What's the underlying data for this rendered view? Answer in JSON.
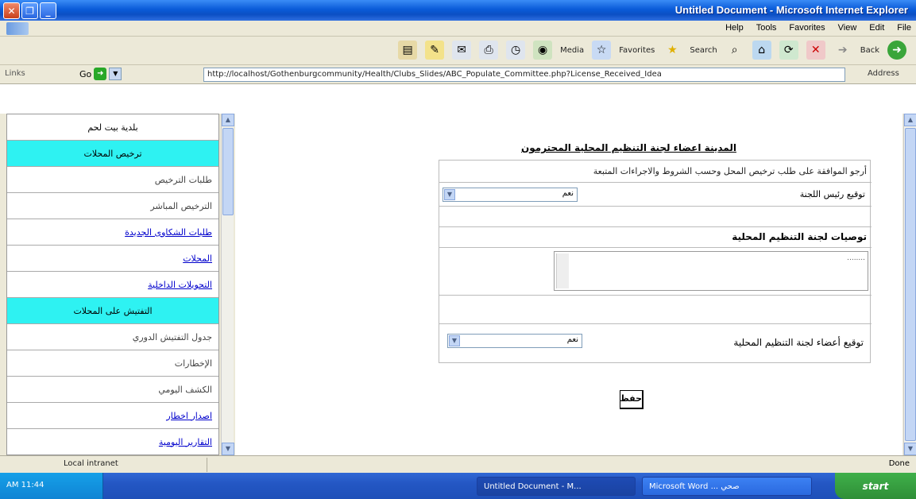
{
  "window": {
    "title": "Untitled Document - Microsoft Internet Explorer"
  },
  "menu": {
    "items": [
      "Help",
      "Tools",
      "Favorites",
      "View",
      "Edit",
      "File"
    ]
  },
  "toolbar": {
    "media": "Media",
    "favorites": "Favorites",
    "search": "Search",
    "back": "Back"
  },
  "addressbar": {
    "links": "Links",
    "go": "Go",
    "url": "http://localhost/Gothenburgcommunity/Health/Clubs_Slides/ABC_Populate_Committee.php?License_Received_Idea",
    "label": "Address"
  },
  "sidebar": {
    "items": [
      {
        "text": "بلدية بيت لحم",
        "kind": "top"
      },
      {
        "text": "ترخيص المحلات",
        "kind": "header"
      },
      {
        "text": "طلبات الترخيص",
        "kind": "plain"
      },
      {
        "text": "الترخيص المباشر",
        "kind": "plain"
      },
      {
        "text": "طلبات الشكاوى الجديدة",
        "kind": "link"
      },
      {
        "text": "المحلات",
        "kind": "link"
      },
      {
        "text": "التحويلات الداخلية",
        "kind": "link"
      },
      {
        "text": "التفتيش على المحلات",
        "kind": "header"
      },
      {
        "text": "جدول التفتيش الدوري",
        "kind": "plain"
      },
      {
        "text": "الإخطارات",
        "kind": "plain"
      },
      {
        "text": "الكشف اليومي",
        "kind": "plain"
      },
      {
        "text": "اصدار اخطار",
        "kind": "link"
      },
      {
        "text": "التقارير اليومية",
        "kind": "link"
      }
    ]
  },
  "form": {
    "heading": "المدينة اعضاء لجنة التنظيم المحلية المحترمون",
    "row1_text": "أرجو الموافقة على طلب ترخيص المحل وحسب الشروط والاجراءات المتبعة",
    "row2_label": "توقيع رئيس اللجنة",
    "row2_value": "نعم",
    "recommendations_label": "توصيات لجنة التنظيم المحلية",
    "textarea_text": "........",
    "row7_label": "توقيع أعضاء لجنة التنظيم المحلية",
    "row7_value": "نعم",
    "save": "حفظ"
  },
  "status": {
    "zone": "Local intranet",
    "done": "Done"
  },
  "taskbar": {
    "time": "AM 11:44",
    "ie_task": "Untitled Document - M...",
    "word_task": "Microsoft Word ... صحي",
    "start": "start"
  }
}
